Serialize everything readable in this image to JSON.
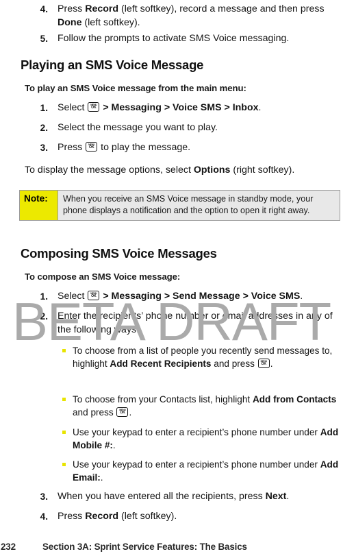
{
  "watermark": {
    "text": "BETA DRAFT"
  },
  "key_icon": {
    "line1": "MENU",
    "line2": "OK",
    "name": "menu-ok-key-icon"
  },
  "colors": {
    "note_label_bg": "#ece900",
    "note_body_bg": "#e8e8e8",
    "note_border": "#9a9a9a",
    "bullet": "#e8e400",
    "watermark": "#aaaaaa",
    "text": "#141414"
  },
  "top_steps": [
    {
      "number": "4.",
      "text_parts": [
        {
          "t": "Press ",
          "b": false
        },
        {
          "t": "Record",
          "b": true
        },
        {
          "t": " (left softkey), record a message and then press ",
          "b": false
        },
        {
          "t": "Done",
          "b": true
        },
        {
          "t": " (left softkey).",
          "b": false
        }
      ]
    },
    {
      "number": "5.",
      "text_parts": [
        {
          "t": "Follow the prompts to activate SMS Voice messaging.",
          "b": false
        }
      ]
    }
  ],
  "section_playing": {
    "heading": "Playing an SMS Voice Message",
    "lead": "To play an SMS Voice message from the main menu:",
    "steps": [
      {
        "number": "1.",
        "text_parts": [
          {
            "t": "Select ",
            "b": false
          },
          {
            "icon": true
          },
          {
            "t": " > ",
            "b": true
          },
          {
            "t": "Messaging",
            "b": true
          },
          {
            "t": " > ",
            "b": true
          },
          {
            "t": "Voice SMS",
            "b": true
          },
          {
            "t": " > ",
            "b": true
          },
          {
            "t": "Inbox",
            "b": true
          },
          {
            "t": ".",
            "b": false
          }
        ]
      },
      {
        "number": "2.",
        "text_parts": [
          {
            "t": "Select the message you want to play.",
            "b": false
          }
        ]
      },
      {
        "number": "3.",
        "text_parts": [
          {
            "t": "Press ",
            "b": false
          },
          {
            "icon": true
          },
          {
            "t": " to play the message.",
            "b": false
          }
        ]
      }
    ],
    "closing_parts": [
      {
        "t": "To display the message options, select ",
        "b": false
      },
      {
        "t": "Options",
        "b": true
      },
      {
        "t": " (right softkey).",
        "b": false
      }
    ]
  },
  "note": {
    "label": "Note:",
    "body": "When you receive an SMS Voice message in standby mode, your phone displays a notification and the option to open it right away."
  },
  "section_composing": {
    "heading": "Composing SMS Voice Messages",
    "lead": "To compose an SMS Voice message:",
    "steps": [
      {
        "number": "1.",
        "text_parts": [
          {
            "t": "Select ",
            "b": false
          },
          {
            "icon": true
          },
          {
            "t": " > ",
            "b": true
          },
          {
            "t": "Messaging",
            "b": true
          },
          {
            "t": " > ",
            "b": true
          },
          {
            "t": "Send Message",
            "b": true
          },
          {
            "t": " > ",
            "b": true
          },
          {
            "t": "Voice SMS",
            "b": true
          },
          {
            "t": ".",
            "b": false
          }
        ]
      },
      {
        "number": "2.",
        "text_parts": [
          {
            "t": "Enter the recipients’ phone number or email addresses in any of the following ways:",
            "b": false
          }
        ]
      }
    ],
    "bullets": [
      {
        "text_parts": [
          {
            "t": "To choose from a list of people you recently send messages to, highlight ",
            "b": false
          },
          {
            "t": "Add Recent Recipients",
            "b": true
          },
          {
            "t": " and press ",
            "b": false
          },
          {
            "icon": true
          },
          {
            "t": ".",
            "b": false
          }
        ]
      },
      {
        "text_parts": [
          {
            "t": "To choose from your Contacts list, highlight ",
            "b": false
          },
          {
            "t": "Add from Contacts",
            "b": true
          },
          {
            "t": " and press ",
            "b": false
          },
          {
            "icon": true
          },
          {
            "t": ".",
            "b": false
          }
        ]
      },
      {
        "text_parts": [
          {
            "t": "Use your keypad to enter a recipient’s phone number under ",
            "b": false
          },
          {
            "t": "Add Mobile #:",
            "b": true
          },
          {
            "t": ".",
            "b": false
          }
        ]
      },
      {
        "text_parts": [
          {
            "t": "Use your keypad to enter a recipient’s phone number under ",
            "b": false
          },
          {
            "t": "Add Email:",
            "b": true
          },
          {
            "t": ".",
            "b": false
          }
        ]
      }
    ],
    "final_steps": [
      {
        "number": "3.",
        "text_parts": [
          {
            "t": "When you have entered all the recipients, press ",
            "b": false
          },
          {
            "t": "Next",
            "b": true
          },
          {
            "t": ".",
            "b": false
          }
        ]
      },
      {
        "number": "4.",
        "text_parts": [
          {
            "t": "Press ",
            "b": false
          },
          {
            "t": "Record",
            "b": true
          },
          {
            "t": " (left softkey).",
            "b": false
          }
        ]
      }
    ]
  },
  "footer": {
    "page_number": "232",
    "section_title": "Section 3A: Sprint Service Features: The Basics"
  }
}
